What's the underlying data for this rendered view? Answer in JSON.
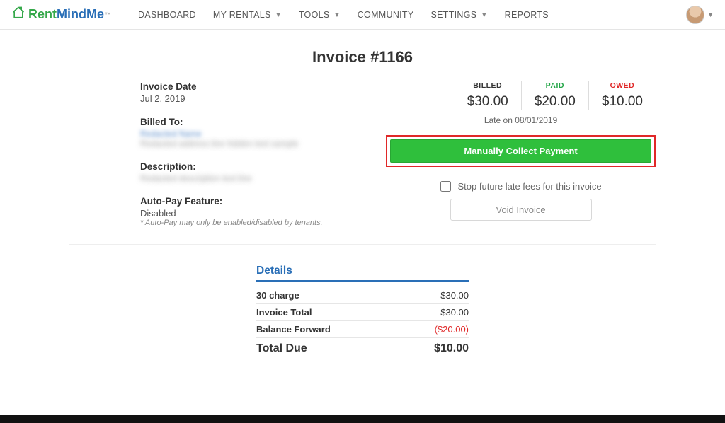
{
  "brand": {
    "rent": "Rent",
    "mindme": "MindMe",
    "tm": "™"
  },
  "nav": {
    "dashboard": "DASHBOARD",
    "myrentals": "MY RENTALS",
    "tools": "TOOLS",
    "community": "COMMUNITY",
    "settings": "SETTINGS",
    "reports": "REPORTS"
  },
  "title": "Invoice #1166",
  "left": {
    "invoice_date_label": "Invoice Date",
    "invoice_date": "Jul 2, 2019",
    "billed_to_label": "Billed To:",
    "billed_name_obscured": "Redacted Name",
    "billed_addr_obscured": "Redacted address line hidden text sample",
    "desc_label": "Description:",
    "desc_obscured": "Redacted description text line",
    "autopay_label": "Auto-Pay Feature:",
    "autopay_value": "Disabled",
    "autopay_note": "* Auto-Pay may only be enabled/disabled by tenants."
  },
  "amounts": {
    "billed_label": "BILLED",
    "billed": "$30.00",
    "paid_label": "PAID",
    "paid": "$20.00",
    "owed_label": "OWED",
    "owed": "$10.00"
  },
  "late_text": "Late on 08/01/2019",
  "buttons": {
    "collect": "Manually Collect Payment",
    "stop_fees": "Stop future late fees for this invoice",
    "void": "Void Invoice"
  },
  "details": {
    "title": "Details",
    "rows": {
      "charge_label": "30 charge",
      "charge_val": "$30.00",
      "total_label": "Invoice Total",
      "total_val": "$30.00",
      "balance_label": "Balance Forward",
      "balance_val": "($20.00)",
      "due_label": "Total Due",
      "due_val": "$10.00"
    }
  }
}
